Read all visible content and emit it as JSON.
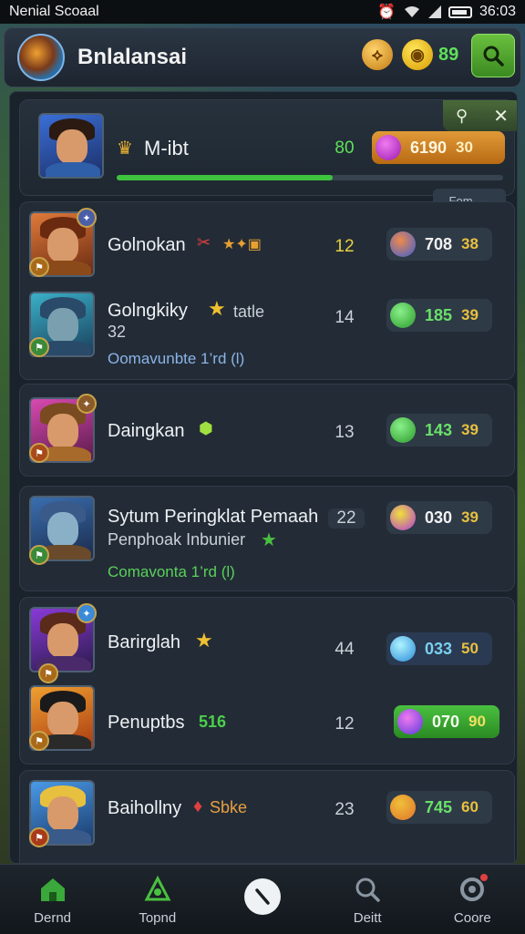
{
  "status_bar": {
    "carrier": "Nenial Scoaal",
    "time": "36:03"
  },
  "header": {
    "title": "Bnlalansai",
    "counter": "89"
  },
  "featured": {
    "name": "M-ibt",
    "level": "80",
    "price_value": "6190",
    "price_sub": "30",
    "progress": 0.56
  },
  "filter": {
    "label": "Fom"
  },
  "players": [
    {
      "name": "Golnokan",
      "level": "12",
      "price_value": "708",
      "price_sub": "38",
      "gem_color": "#3a5ed8"
    },
    {
      "name": "Golngkiky",
      "tag": "tatle",
      "sub": "32",
      "detail": "Oomavunbte 1’rd (l)",
      "level": "14",
      "price_value": "185",
      "price_sub": "39",
      "gem_color": "#3cc03c"
    },
    {
      "name": "Daingkan",
      "level": "13",
      "price_value": "143",
      "price_sub": "39",
      "gem_color": "#3cc03c"
    },
    {
      "name": "Sytum Peringklat Pemaah",
      "sub": "Penphoak Inbunier",
      "detail": "Comavonta 1’rd (l)",
      "level": "22",
      "price_value": "030",
      "price_sub": "39",
      "gem_color": "#b03ad8"
    },
    {
      "name": "Barirglah",
      "level": "44",
      "price_value": "033",
      "price_sub": "50",
      "gem_color": "#3ad0e8"
    },
    {
      "name": "Penuptbs",
      "tag": "516",
      "level": "12",
      "price_value": "070",
      "price_sub": "90",
      "gem_color": "#c03ad8"
    },
    {
      "name": "Baihollny",
      "tag": "Sbke",
      "level": "23",
      "price_value": "745",
      "price_sub": "60",
      "gem_color": "#e0742a"
    }
  ],
  "nav": [
    {
      "label": "Dernd",
      "icon": "home-icon"
    },
    {
      "label": "Topnd",
      "icon": "trophy-icon"
    },
    {
      "label": "",
      "icon": "compass-icon"
    },
    {
      "label": "Deitt",
      "icon": "search-icon"
    },
    {
      "label": "Coore",
      "icon": "settings-icon"
    }
  ]
}
